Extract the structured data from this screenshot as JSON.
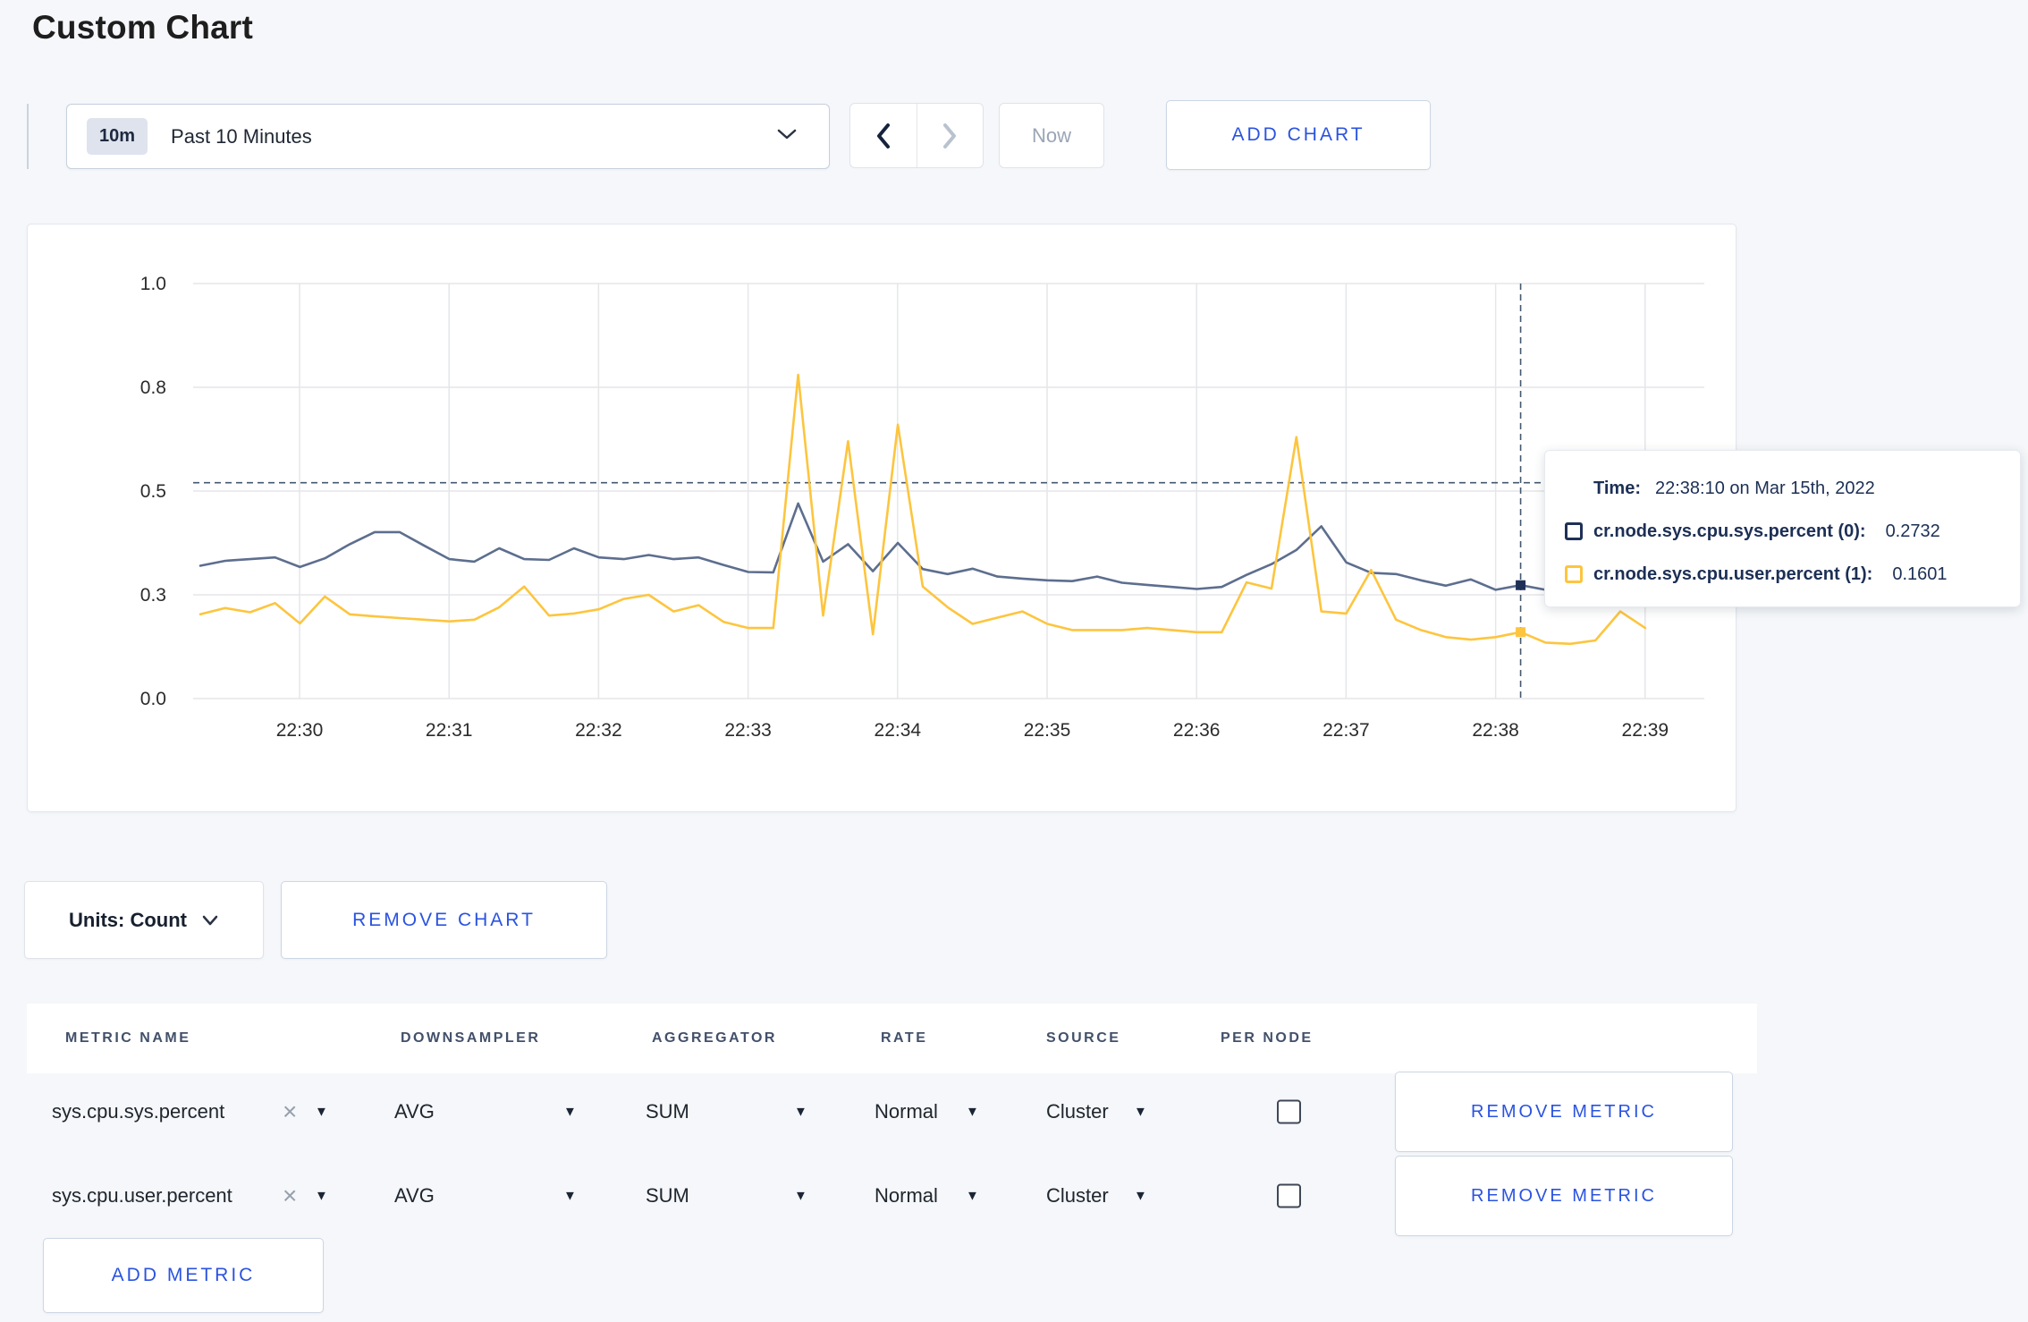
{
  "page": {
    "title": "Custom Chart"
  },
  "toolbar": {
    "time_badge": "10m",
    "time_label": "Past 10 Minutes",
    "now_label": "Now",
    "add_chart_label": "ADD CHART"
  },
  "colors": {
    "accent_blue": "#2a53e0",
    "series_sys_line": "#5d6e8e",
    "series_sys_marker": "#1f3057",
    "series_user_line": "#fdc53e",
    "crosshair": "#44586e",
    "grid": "#e5e6e8"
  },
  "chart_data": {
    "type": "line",
    "title": "",
    "xlabel": "",
    "ylabel": "",
    "ylim": [
      0,
      1
    ],
    "grid": true,
    "y_tick_labels": [
      "0.0",
      "0.3",
      "0.5",
      "0.8",
      "1.0"
    ],
    "y_tick_values": [
      0,
      0.25,
      0.5,
      0.75,
      1.0
    ],
    "x_tick_labels": [
      "22:30",
      "22:31",
      "22:32",
      "22:33",
      "22:34",
      "22:35",
      "22:36",
      "22:37",
      "22:38",
      "22:39"
    ],
    "x_start": "22:29:20",
    "x_interval_seconds": 10,
    "series": [
      {
        "name": "cr.node.sys.cpu.sys.percent",
        "color": "#5d6e8e",
        "marker_color": "#1f3057",
        "values": [
          0.32,
          0.332,
          0.336,
          0.34,
          0.317,
          0.338,
          0.372,
          0.401,
          0.401,
          0.368,
          0.336,
          0.33,
          0.362,
          0.336,
          0.334,
          0.362,
          0.34,
          0.336,
          0.346,
          0.336,
          0.34,
          0.322,
          0.305,
          0.304,
          0.47,
          0.33,
          0.372,
          0.307,
          0.375,
          0.312,
          0.3,
          0.313,
          0.294,
          0.289,
          0.285,
          0.283,
          0.294,
          0.279,
          0.274,
          0.269,
          0.264,
          0.269,
          0.298,
          0.324,
          0.358,
          0.415,
          0.328,
          0.303,
          0.3,
          0.285,
          0.272,
          0.287,
          0.262,
          0.2732,
          0.262,
          0.272,
          0.285,
          0.295,
          0.29
        ]
      },
      {
        "name": "cr.node.sys.cpu.user.percent",
        "color": "#fdc53e",
        "marker_color": "#fdc53e",
        "values": [
          0.203,
          0.218,
          0.208,
          0.23,
          0.181,
          0.246,
          0.203,
          0.198,
          0.194,
          0.19,
          0.186,
          0.19,
          0.22,
          0.27,
          0.2,
          0.205,
          0.215,
          0.24,
          0.25,
          0.21,
          0.225,
          0.185,
          0.17,
          0.17,
          0.78,
          0.2,
          0.62,
          0.155,
          0.66,
          0.27,
          0.22,
          0.18,
          0.195,
          0.21,
          0.18,
          0.165,
          0.165,
          0.165,
          0.17,
          0.165,
          0.16,
          0.16,
          0.28,
          0.265,
          0.63,
          0.21,
          0.205,
          0.31,
          0.19,
          0.165,
          0.148,
          0.142,
          0.148,
          0.1601,
          0.135,
          0.132,
          0.14,
          0.21,
          0.17
        ]
      }
    ],
    "crosshair": {
      "time": "22:38:10",
      "index": 53,
      "hline_value": 0.52
    },
    "legend_position": "tooltip"
  },
  "tooltip": {
    "time_label": "Time:",
    "time_value": "22:38:10 on Mar 15th, 2022",
    "rows": [
      {
        "label": "cr.node.sys.cpu.sys.percent (0):",
        "value": "0.2732",
        "swatch_color": "#1f3057"
      },
      {
        "label": "cr.node.sys.cpu.user.percent (1):",
        "value": "0.1601",
        "swatch_color": "#fdc53e"
      }
    ]
  },
  "chart_controls": {
    "units_label": "Units: Count",
    "remove_chart_label": "REMOVE CHART"
  },
  "metrics_table": {
    "headers": [
      "METRIC NAME",
      "DOWNSAMPLER",
      "AGGREGATOR",
      "RATE",
      "SOURCE",
      "PER NODE"
    ],
    "rows": [
      {
        "metric_name": "sys.cpu.sys.percent",
        "downsampler": "AVG",
        "aggregator": "SUM",
        "rate": "Normal",
        "source": "Cluster",
        "per_node_checked": false,
        "remove_label": "REMOVE METRIC"
      },
      {
        "metric_name": "sys.cpu.user.percent",
        "downsampler": "AVG",
        "aggregator": "SUM",
        "rate": "Normal",
        "source": "Cluster",
        "per_node_checked": false,
        "remove_label": "REMOVE METRIC"
      }
    ],
    "add_metric_label": "ADD METRIC"
  },
  "icons": {
    "caret_down_glyph": "▼",
    "clear_glyph": "×"
  }
}
